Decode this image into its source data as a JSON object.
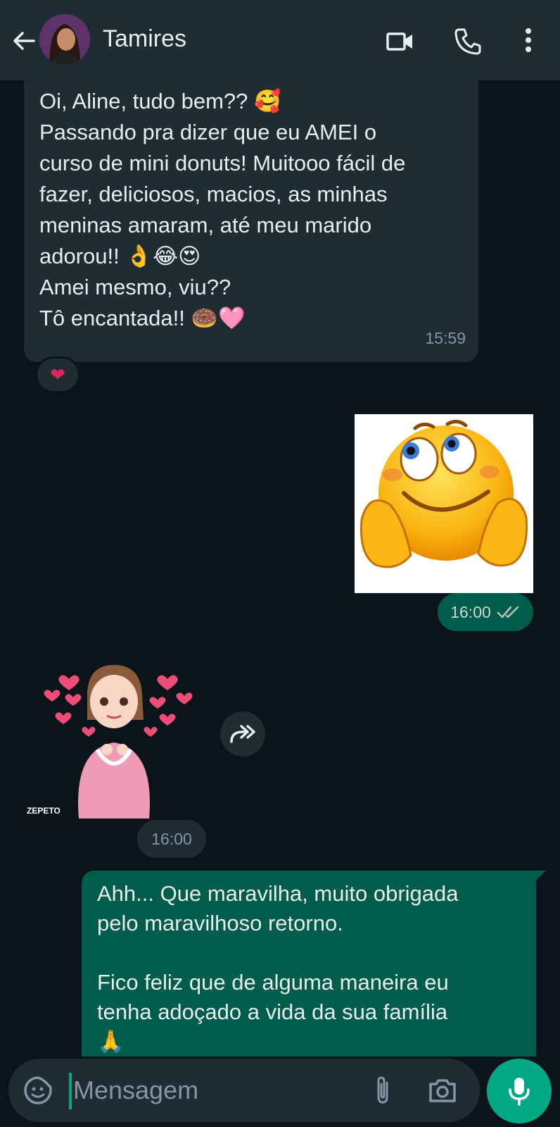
{
  "header": {
    "contact_name": "Tamires",
    "icons": [
      "back-arrow-icon",
      "video-call-icon",
      "phone-icon",
      "more-vert-icon"
    ]
  },
  "messages": [
    {
      "direction": "incoming",
      "lines": [
        "Oi, Aline, tudo bem?? 🥰",
        "Passando pra dizer que eu AMEI o",
        "curso de mini donuts! Muitooo fácil de",
        "fazer, deliciosos, macios, as minhas",
        "meninas amaram, até meu marido",
        "adorou!! 👌😂😍",
        "Amei mesmo, viu??",
        "Tô encantada!! 🍩🩷"
      ],
      "time": "15:59",
      "reaction": "❤"
    },
    {
      "direction": "outgoing",
      "type": "sticker",
      "sticker": "smiling-emoji-with-hands-on-cheeks",
      "time": "16:00",
      "status_icon": "double-check-icon"
    },
    {
      "direction": "incoming",
      "type": "sticker",
      "sticker": "zepeto-avatar-with-hearts",
      "sticker_label": "ZEPETO",
      "time": "16:00"
    },
    {
      "direction": "outgoing",
      "lines_1": [
        "Ahh... Que maravilha, muito obrigada",
        "pelo maravilhoso retorno."
      ],
      "lines_2": [
        "Fico feliz que de alguma maneira eu",
        "tenha adoçado a vida da sua família",
        "🙏"
      ]
    }
  ],
  "input": {
    "placeholder": "Mensagem"
  },
  "colors": {
    "background": "#0b141a",
    "header": "#1f2c34",
    "incoming_bubble": "#1f2c34",
    "outgoing_bubble": "#005c4b",
    "accent": "#00a884",
    "text_primary": "#e9edef",
    "text_secondary": "#8696a0"
  }
}
